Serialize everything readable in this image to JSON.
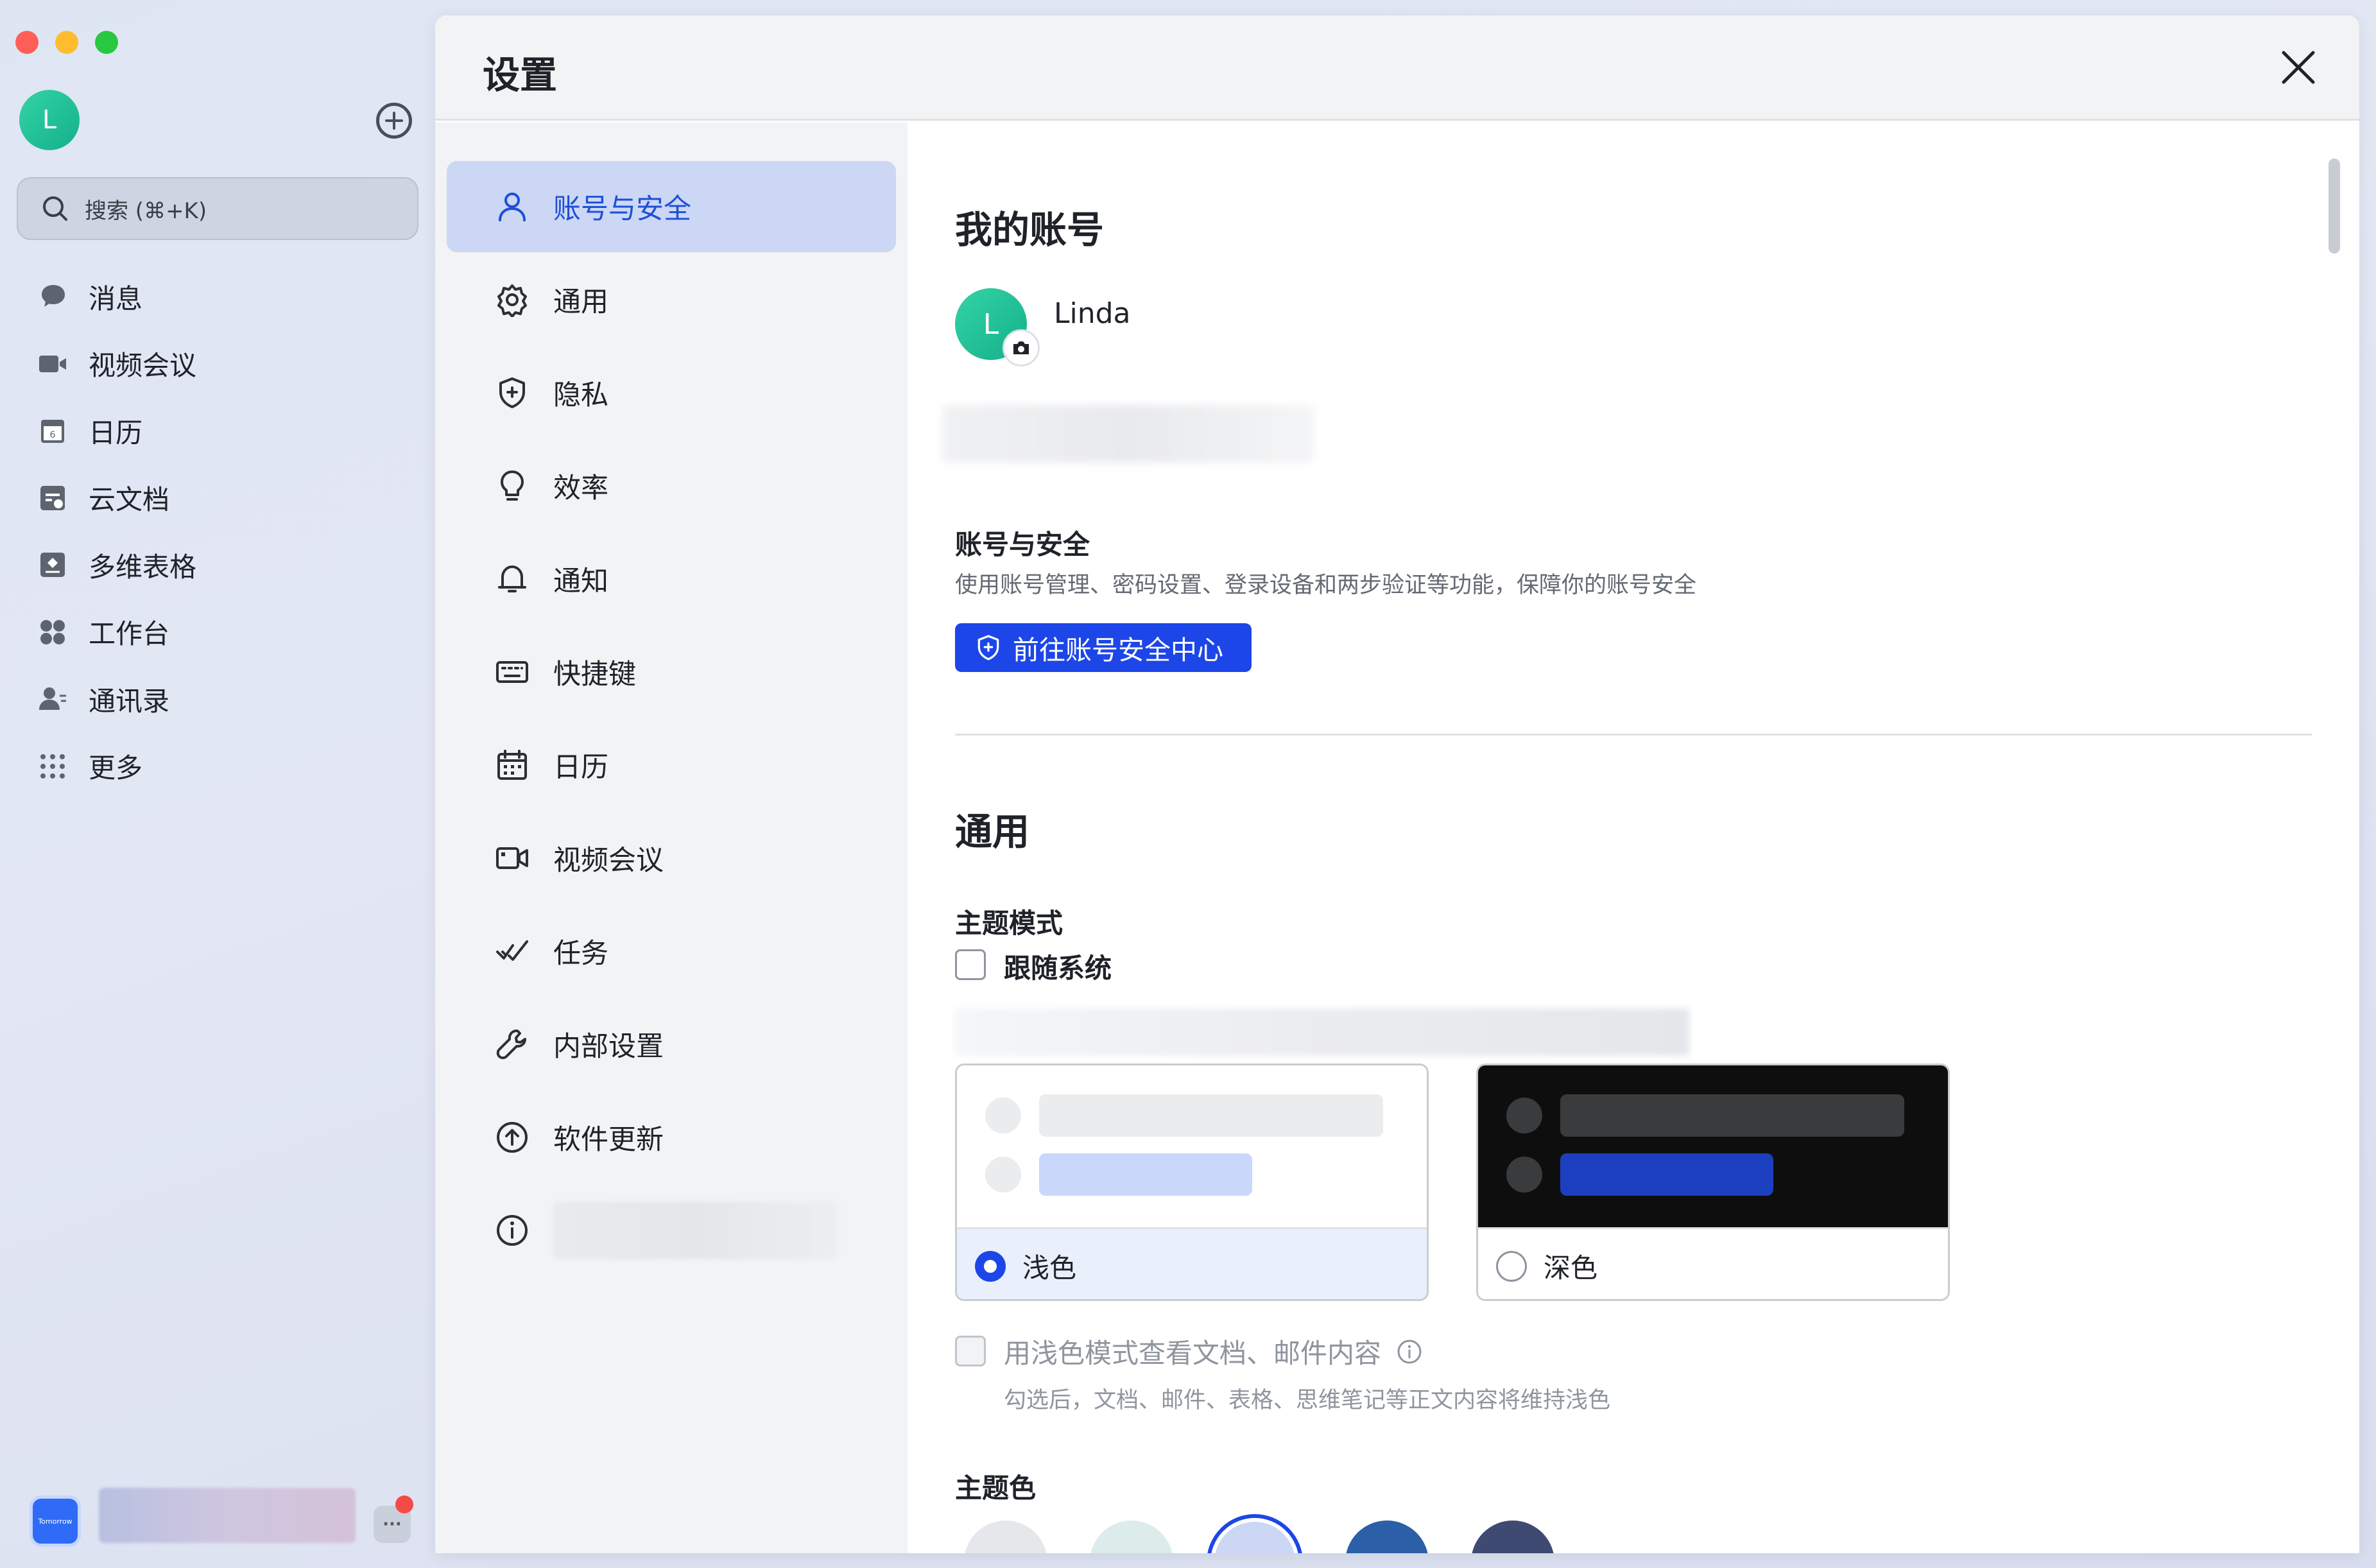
{
  "sidebar": {
    "avatar_letter": "L",
    "search_placeholder": "搜索 (⌘+K)",
    "items": [
      {
        "label": "消息",
        "icon": "chat-bubble-icon"
      },
      {
        "label": "视频会议",
        "icon": "video-camera-icon"
      },
      {
        "label": "日历",
        "icon": "calendar-icon"
      },
      {
        "label": "云文档",
        "icon": "cloud-doc-icon"
      },
      {
        "label": "多维表格",
        "icon": "base-table-icon"
      },
      {
        "label": "工作台",
        "icon": "workplace-icon"
      },
      {
        "label": "通讯录",
        "icon": "contacts-icon"
      },
      {
        "label": "更多",
        "icon": "more-grid-icon"
      }
    ],
    "bottom_badge": "Tomorrow",
    "more_label": "···"
  },
  "dialog": {
    "title": "设置",
    "nav": [
      {
        "label": "账号与安全",
        "icon": "user-icon",
        "active": true
      },
      {
        "label": "通用",
        "icon": "gear-icon"
      },
      {
        "label": "隐私",
        "icon": "shield-icon"
      },
      {
        "label": "效率",
        "icon": "lightbulb-icon"
      },
      {
        "label": "通知",
        "icon": "bell-icon"
      },
      {
        "label": "快捷键",
        "icon": "keyboard-icon"
      },
      {
        "label": "日历",
        "icon": "calendar-icon"
      },
      {
        "label": "视频会议",
        "icon": "video-camera-icon"
      },
      {
        "label": "任务",
        "icon": "task-check-icon"
      },
      {
        "label": "内部设置",
        "icon": "wrench-icon"
      },
      {
        "label": "软件更新",
        "icon": "upload-arrow-icon"
      },
      {
        "label": "",
        "icon": "info-icon"
      }
    ]
  },
  "account": {
    "heading": "我的账号",
    "avatar_letter": "L",
    "name": "Linda",
    "security_title": "账号与安全",
    "security_desc": "使用账号管理、密码设置、登录设备和两步验证等功能，保障你的账号安全",
    "security_button": "前往账号安全中心"
  },
  "general": {
    "heading": "通用",
    "theme_mode_title": "主题模式",
    "follow_system": "跟随系统",
    "light_label": "浅色",
    "dark_label": "深色",
    "selected_theme": "浅色",
    "light_docs_label": "用浅色模式查看文档、邮件内容",
    "light_docs_hint": "勾选后，文档、邮件、表格、思维笔记等正文内容将维持浅色",
    "theme_color_title": "主题色",
    "theme_colors": [
      "#e6e7ea",
      "#dbeceb",
      "#ccd7f5",
      "#2b5fa8",
      "#3e4a72"
    ]
  },
  "colors": {
    "accent": "#1d46e8",
    "active_nav_bg": "#ccd7f5",
    "avatar_green": "#14b08a"
  }
}
